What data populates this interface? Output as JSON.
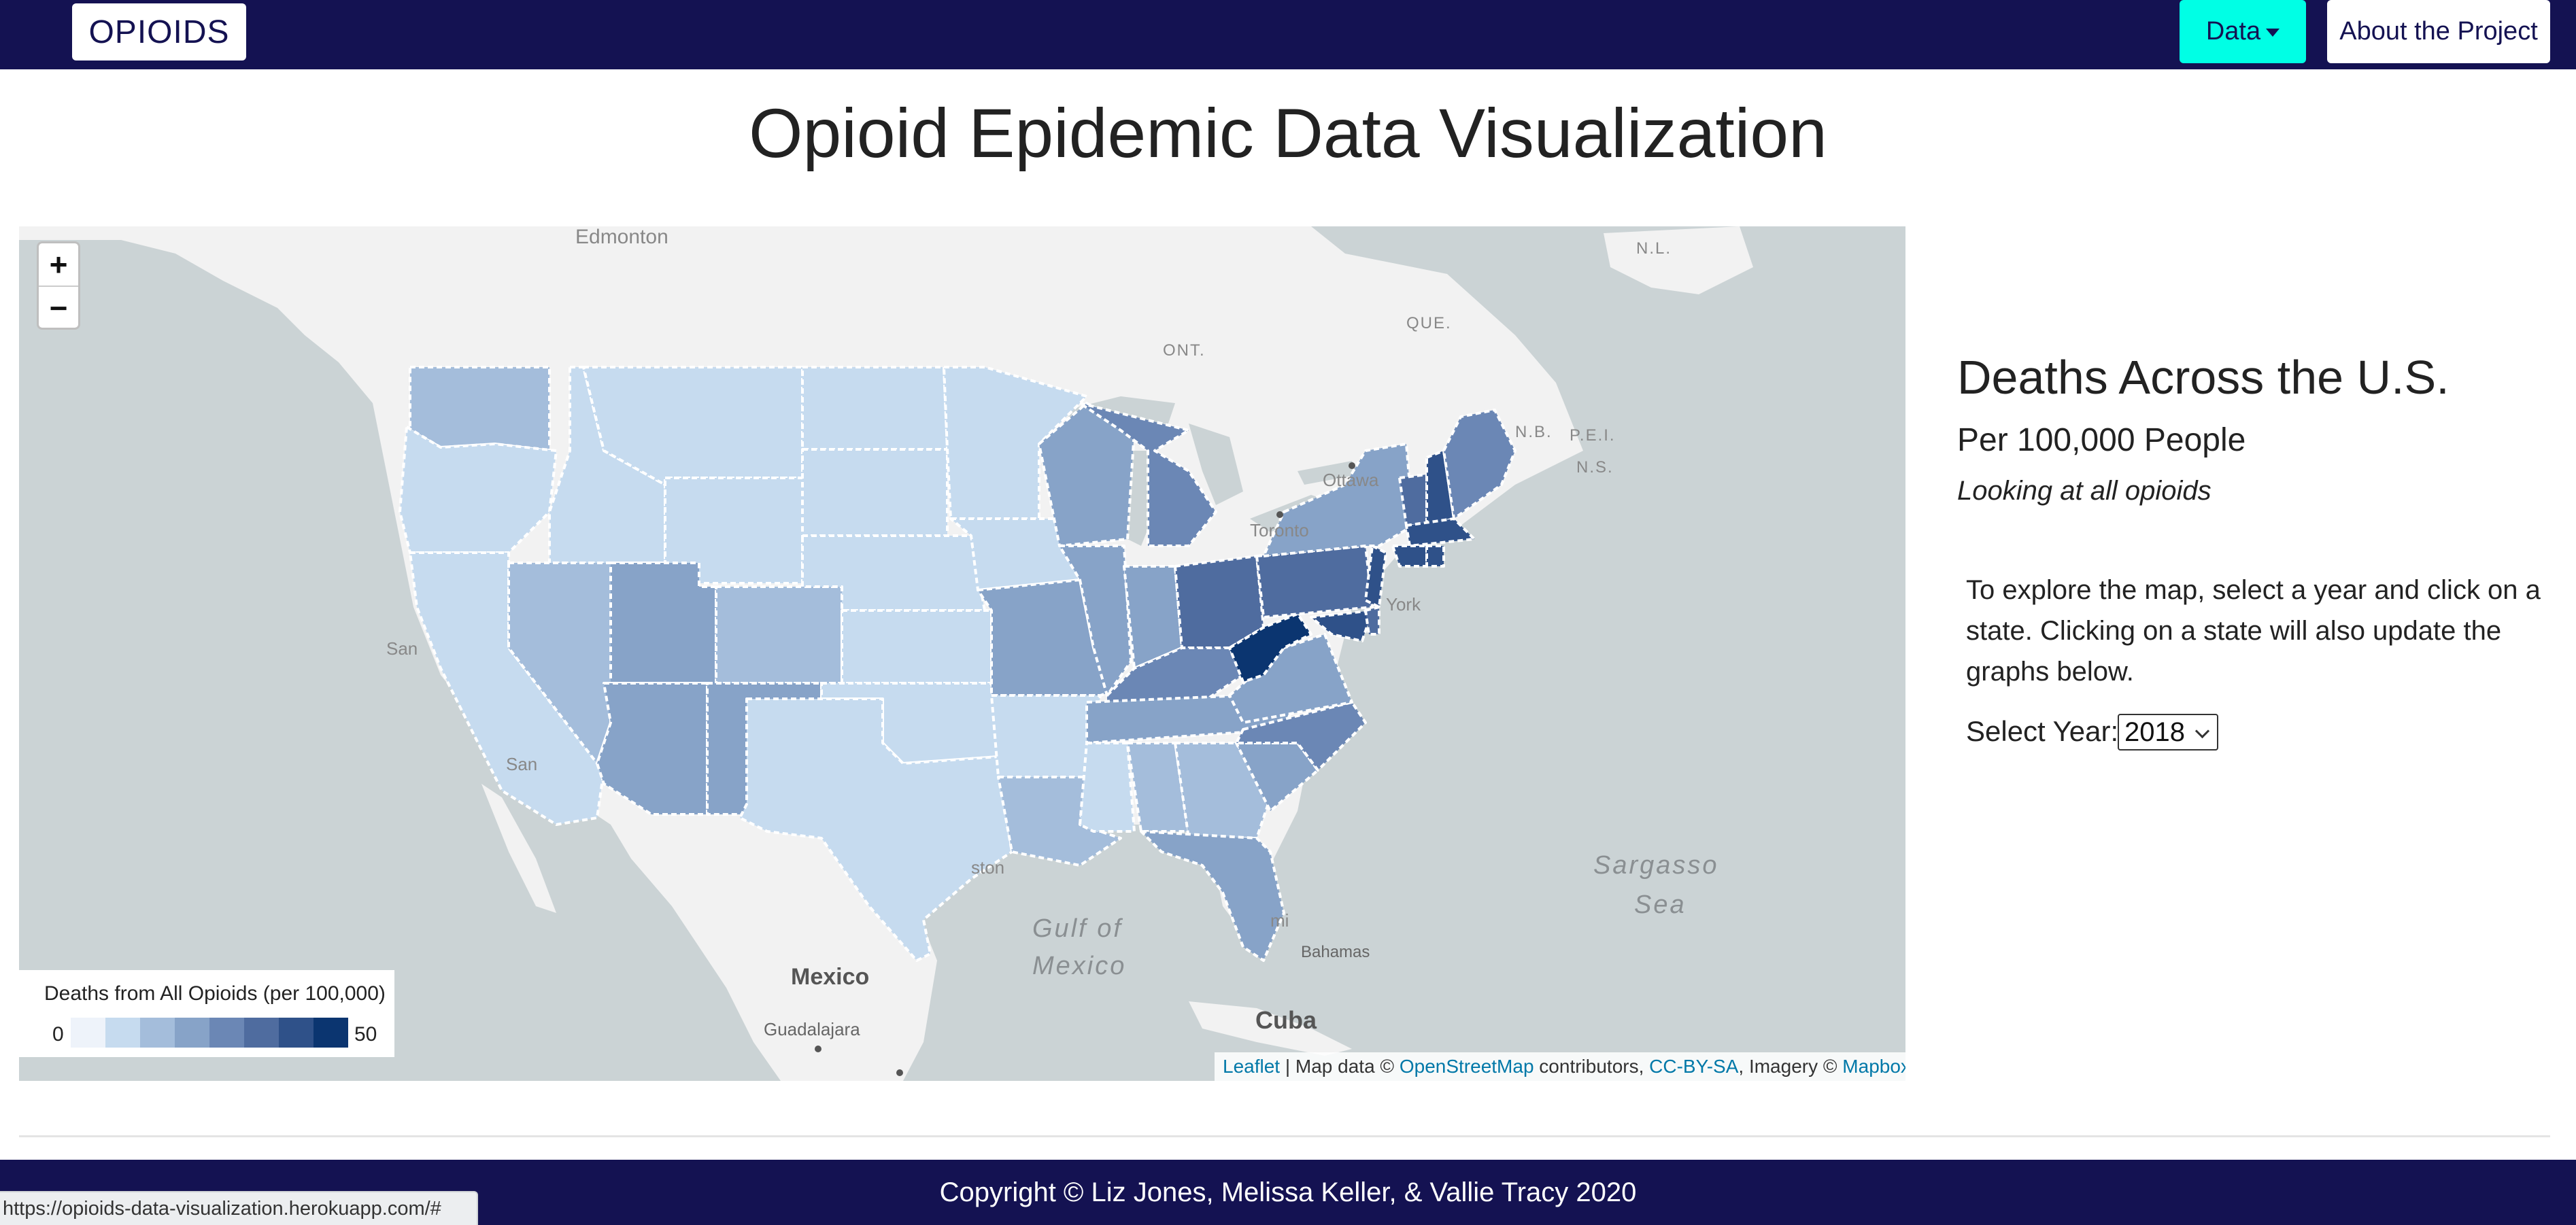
{
  "navbar": {
    "brand": "OPIOIDS",
    "data_label": "Data",
    "about_label": "About the Project"
  },
  "page_title": "Opioid Epidemic Data Visualization",
  "map": {
    "zoom_in": "+",
    "zoom_out": "−",
    "place_labels": [
      "Edmonton",
      "N.L.",
      "QUE.",
      "ONT.",
      "N.B.",
      "P.E.I.",
      "N.S.",
      "Ottawa",
      "Toronto",
      "York",
      "San",
      "San",
      "Mexico",
      "Gulf of",
      "Mexico",
      "Sargasso",
      "Sea",
      "Bahamas",
      "Cuba",
      "Guadalajara",
      "ston",
      "mi"
    ],
    "legend": {
      "title": "Deaths from All Opioids (per 100,000)",
      "min": "0",
      "max": "50",
      "colors": [
        "#eef3fa",
        "#c6dbef",
        "#a4bddb",
        "#87a3c8",
        "#6b87b5",
        "#4f6c9f",
        "#2f5189",
        "#0b3570"
      ]
    },
    "attribution": {
      "leaflet": "Leaflet",
      "sep1": " | Map data © ",
      "osm": "OpenStreetMap",
      "contrib": " contributors, ",
      "cc": "CC-BY-SA",
      "imagery": ", Imagery © ",
      "mapbox": "Mapbox"
    }
  },
  "side_panel": {
    "title": "Deaths Across the U.S.",
    "subtitle": "Per 100,000 People",
    "note": "Looking at all opioids",
    "instructions": "To explore the map, select a year and click on a state. Clicking on a state will also update the graphs below.",
    "select_label": "Select Year:",
    "selected_year": "2018"
  },
  "footer": {
    "copyright": "Copyright © Liz Jones, Melissa Keller, & Vallie Tracy 2020"
  },
  "status_bar": {
    "url": "https://opioids-data-visualization.herokuapp.com/#"
  },
  "colors": {
    "navbar": "#141252",
    "data_button": "#00ffe5",
    "link": "#0078a8"
  }
}
